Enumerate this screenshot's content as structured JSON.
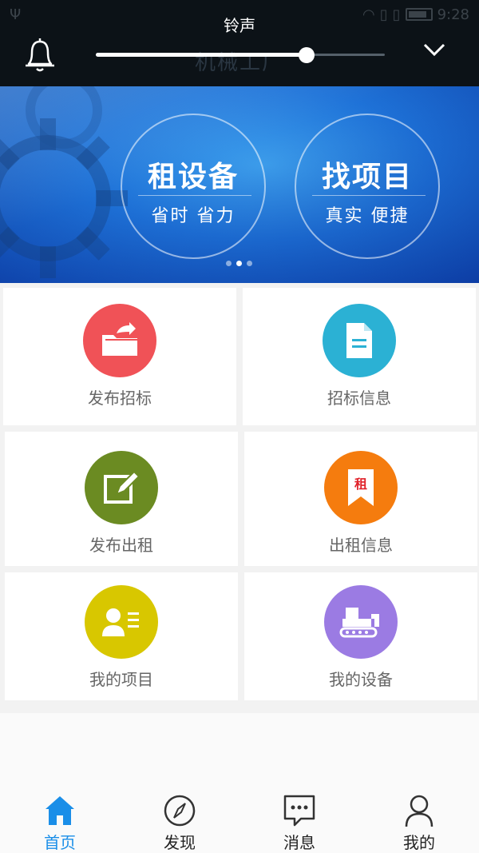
{
  "overlay": {
    "title": "铃声",
    "ghost_title": "机械工厂",
    "volume_level": 0.73,
    "status_time": "9:28"
  },
  "banner": {
    "left_badge": {
      "main": "租设备",
      "sub": "省时 省力"
    },
    "right_badge": {
      "main": "找项目",
      "sub": "真实 便捷"
    },
    "page_count": 3,
    "active_page": 1
  },
  "grid": [
    {
      "label": "发布招标",
      "icon": "folder-share-icon",
      "color": "#f05257"
    },
    {
      "label": "招标信息",
      "icon": "document-icon",
      "color": "#2bb1d4"
    },
    {
      "label": "发布出租",
      "icon": "edit-pencil-icon",
      "color": "#6b8b22"
    },
    {
      "label": "出租信息",
      "icon": "rent-bookmark-icon",
      "color": "#f57c0e"
    },
    {
      "label": "我的项目",
      "icon": "profile-card-icon",
      "color": "#d8c700"
    },
    {
      "label": "我的设备",
      "icon": "excavator-icon",
      "color": "#9b7be3"
    }
  ],
  "rent_badge_text": "租",
  "tabs": [
    {
      "label": "首页",
      "icon": "home-icon",
      "active": true
    },
    {
      "label": "发现",
      "icon": "compass-icon",
      "active": false
    },
    {
      "label": "消息",
      "icon": "chat-bubble-icon",
      "active": false
    },
    {
      "label": "我的",
      "icon": "user-icon",
      "active": false
    }
  ],
  "colors": {
    "accent": "#1a8ee8",
    "overlay_bg": "#0c1217"
  }
}
